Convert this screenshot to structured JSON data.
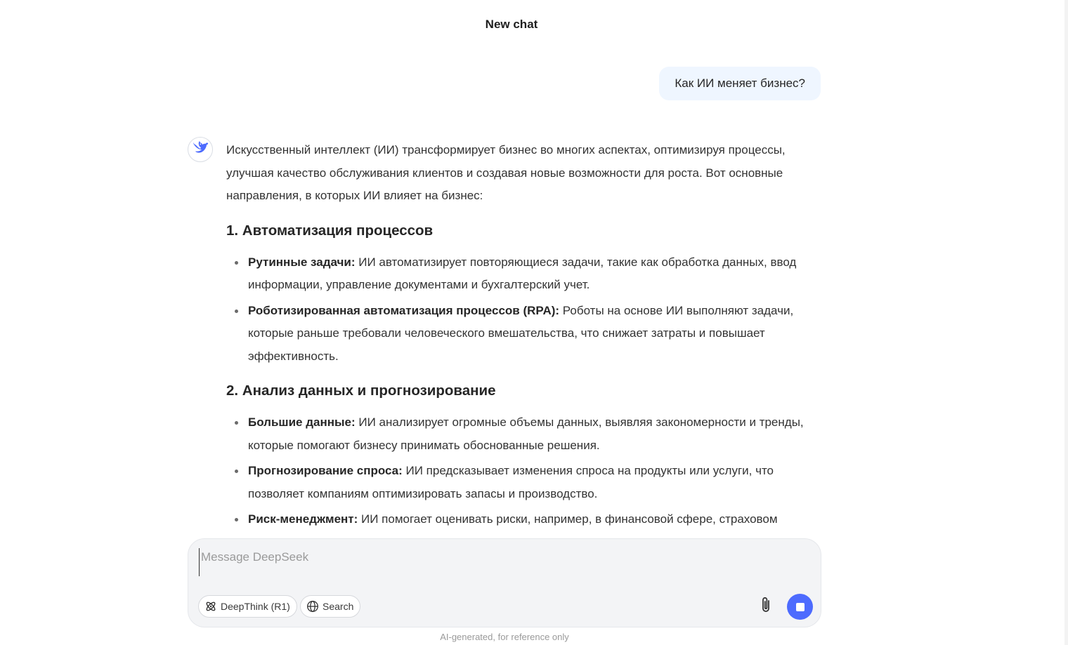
{
  "header": {
    "title": "New chat"
  },
  "user_message": {
    "text": "Как ИИ меняет бизнес?"
  },
  "assistant": {
    "avatar_icon": "deepseek-whale-icon",
    "intro": "Искусственный интеллект (ИИ) трансформирует бизнес во многих аспектах, оптимизируя процессы, улучшая качество обслуживания клиентов и создавая новые возможности для роста. Вот основные направления, в которых ИИ влияет на бизнес:",
    "sections": [
      {
        "heading": "1. Автоматизация процессов",
        "items": [
          {
            "label": "Рутинные задачи:",
            "text": " ИИ автоматизирует повторяющиеся задачи, такие как обработка данных, ввод информации, управление документами и бухгалтерский учет."
          },
          {
            "label": "Роботизированная автоматизация процессов (RPA):",
            "text": " Роботы на основе ИИ выполняют задачи, которые раньше требовали человеческого вмешательства, что снижает затраты и повышает эффективность."
          }
        ]
      },
      {
        "heading": "2. Анализ данных и прогнозирование",
        "items": [
          {
            "label": "Большие данные:",
            "text": " ИИ анализирует огромные объемы данных, выявляя закономерности и тренды, которые помогают бизнесу принимать обоснованные решения."
          },
          {
            "label": "Прогнозирование спроса:",
            "text": " ИИ предсказывает изменения спроса на продукты или услуги, что позволяет компаниям оптимизировать запасы и производство."
          },
          {
            "label": "Риск-менеджмент:",
            "text": " ИИ помогает оценивать риски, например, в финансовой сфере, страховом"
          }
        ]
      }
    ]
  },
  "composer": {
    "placeholder": "Message DeepSeek",
    "value": "",
    "deepthink_label": "DeepThink (R1)",
    "deepthink_icon": "atom-icon",
    "search_label": "Search",
    "search_icon": "globe-icon",
    "attach_icon": "paperclip-icon",
    "send_icon": "stop-icon",
    "accent_color": "#4d6bfe"
  },
  "footer": {
    "disclaimer": "AI-generated, for reference only"
  }
}
